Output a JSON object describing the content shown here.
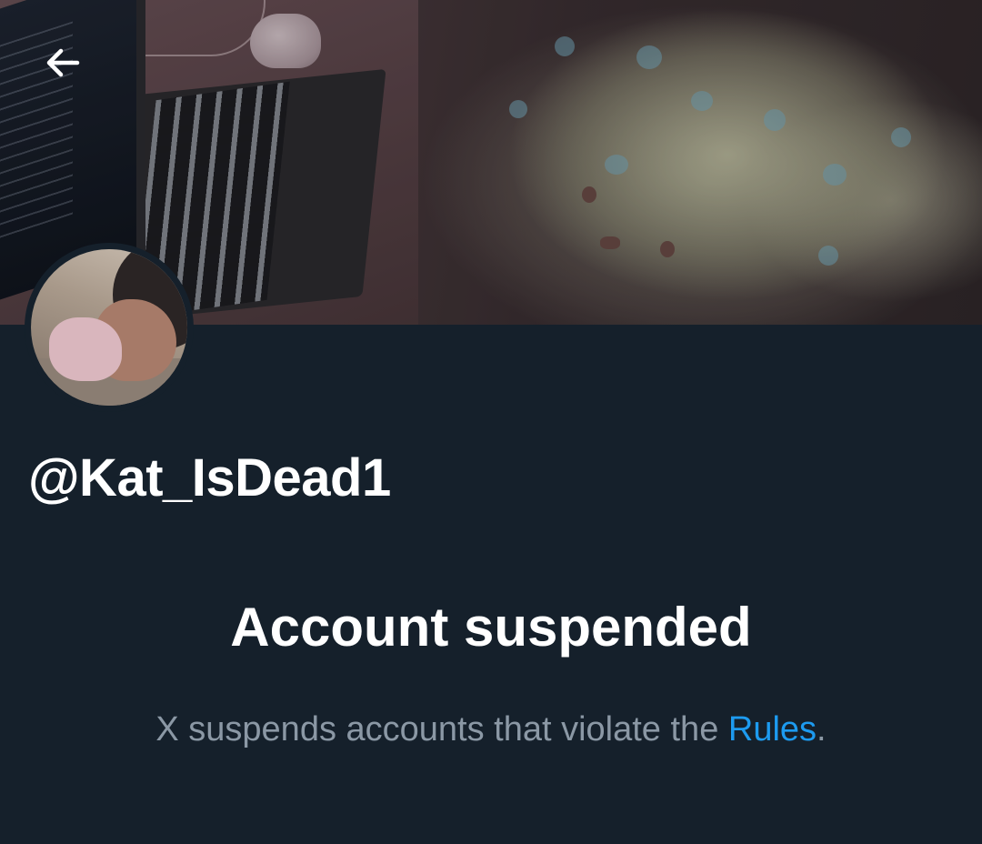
{
  "profile": {
    "handle": "@Kat_IsDead1"
  },
  "notice": {
    "title": "Account suspended",
    "text_before_link": "X suspends accounts that violate the ",
    "link_label": "Rules",
    "text_after_link": "."
  },
  "icons": {
    "back": "arrow-left-icon"
  },
  "colors": {
    "background": "#15202b",
    "primary_text": "#ffffff",
    "secondary_text": "#8b98a5",
    "link": "#1d9bf0"
  }
}
